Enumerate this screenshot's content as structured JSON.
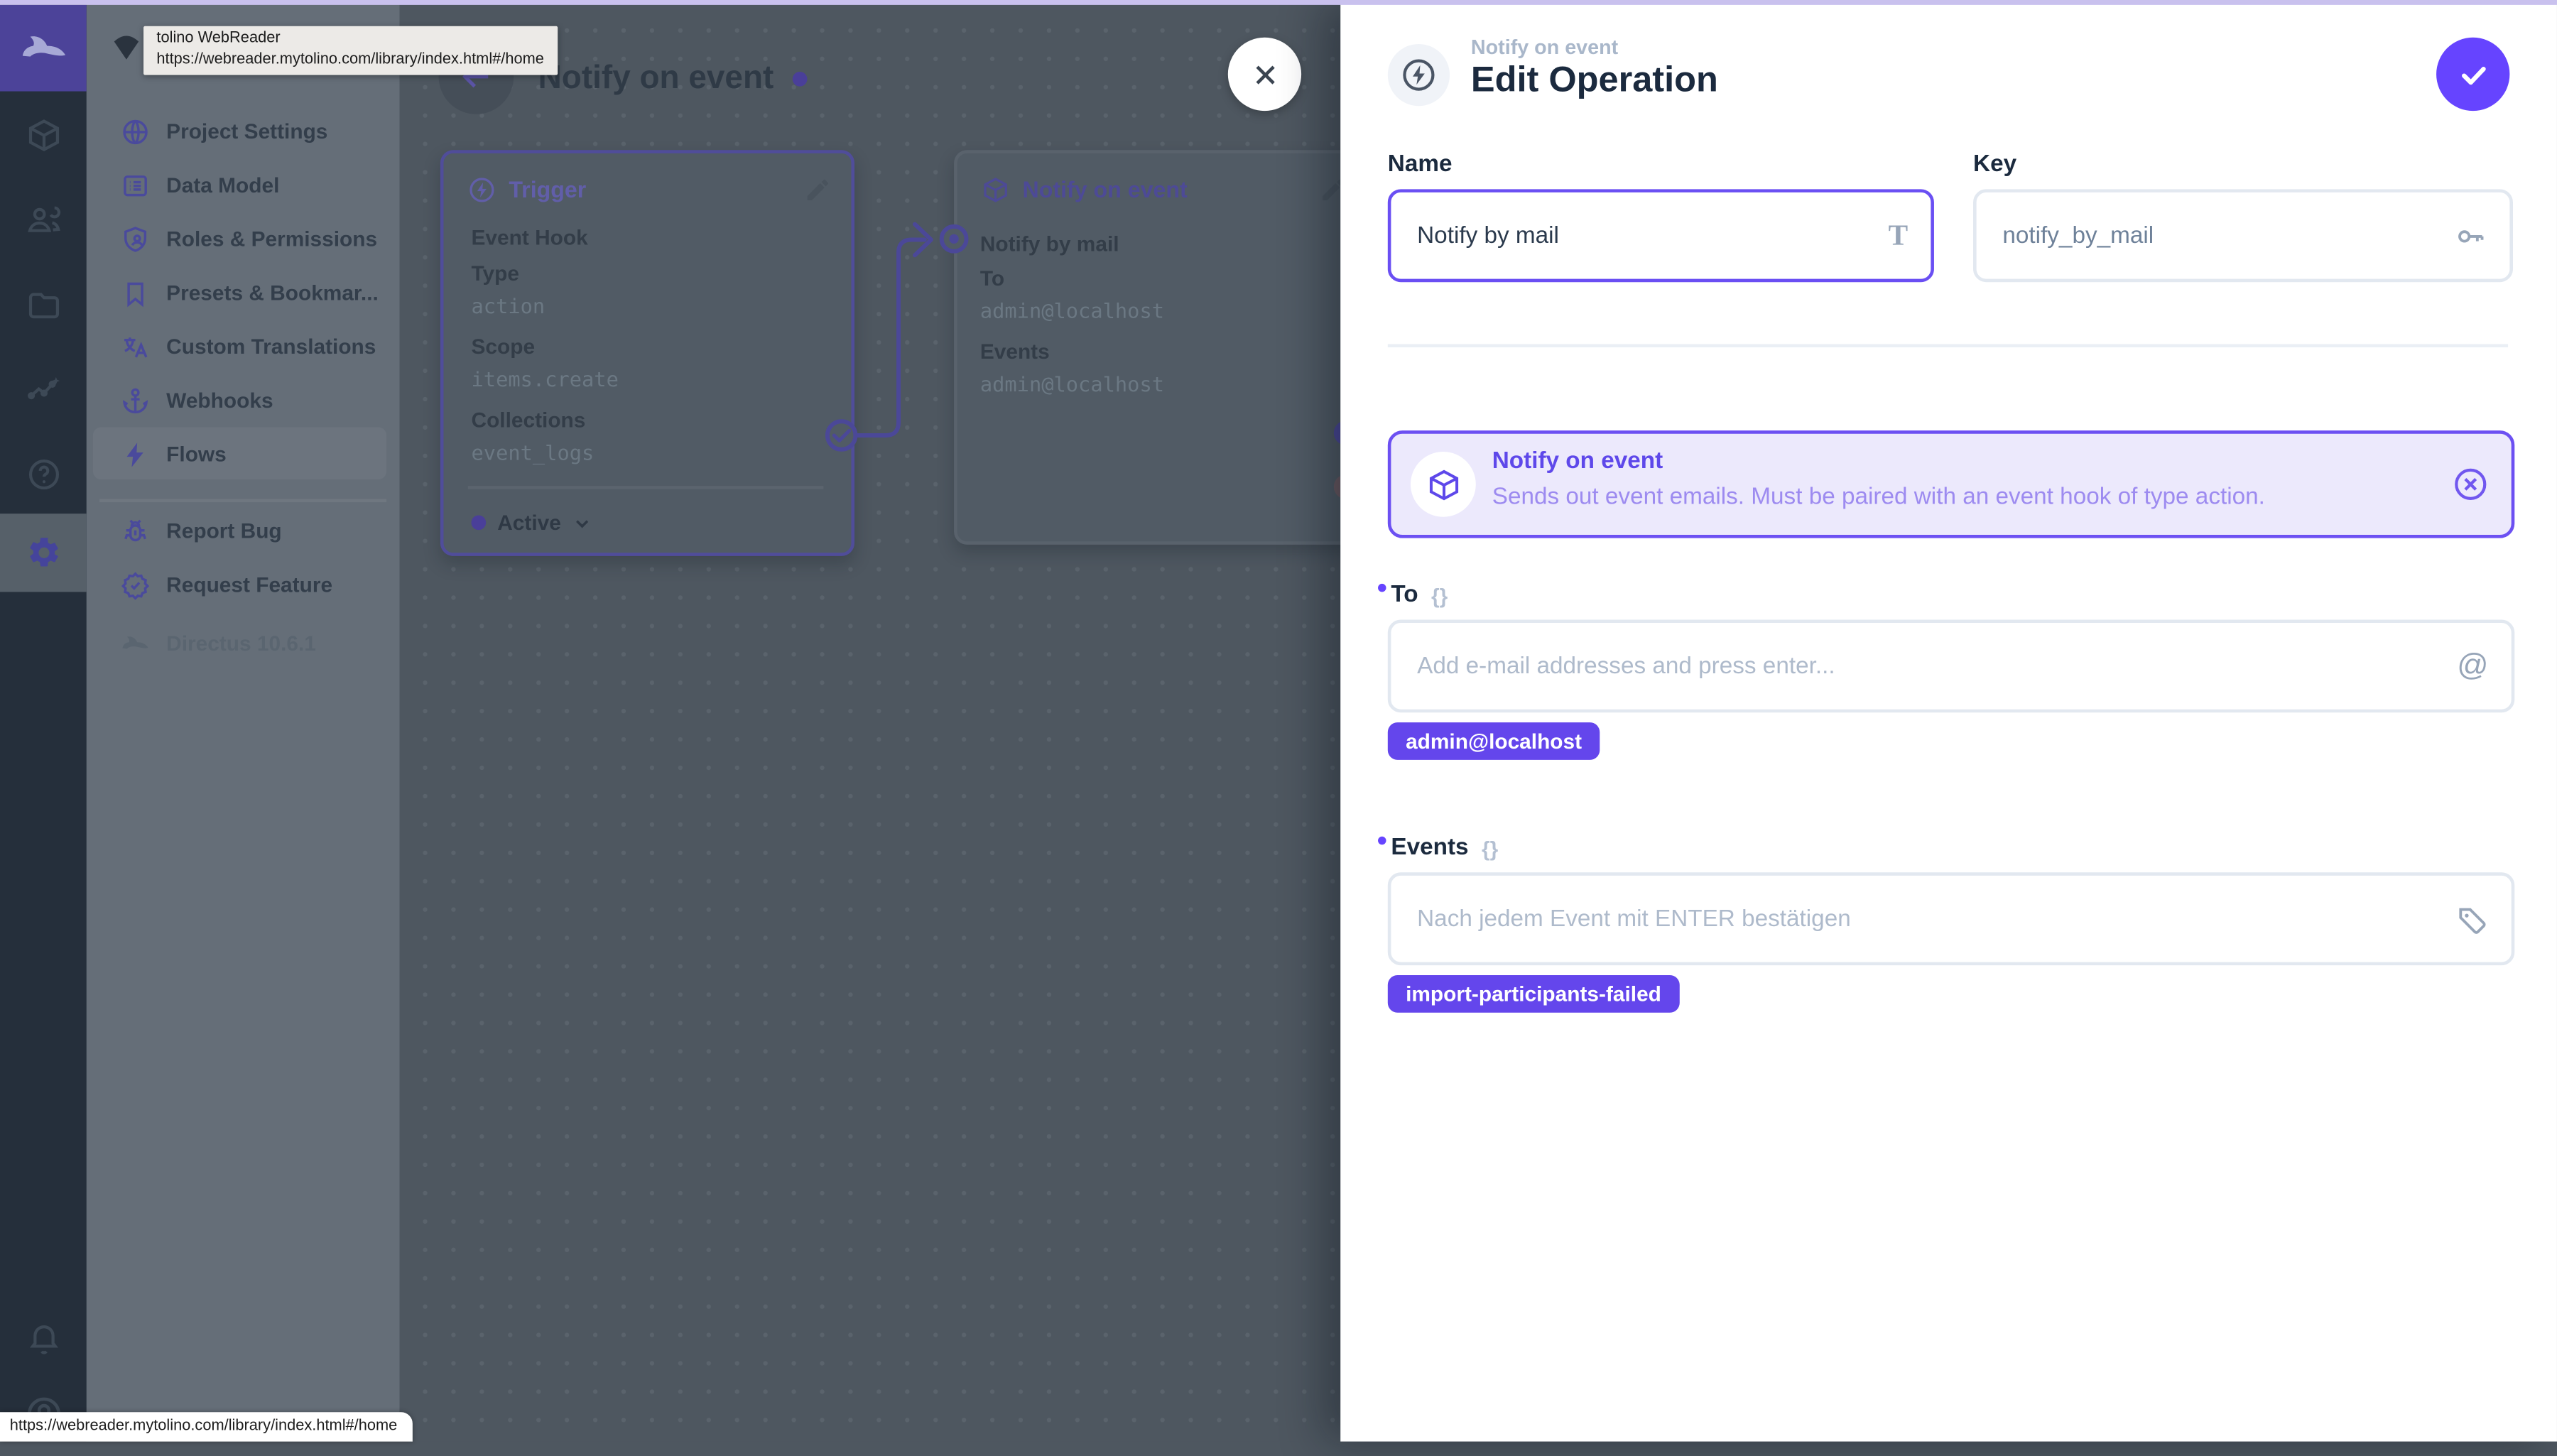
{
  "browser": {
    "tooltip": {
      "title": "tolino WebReader",
      "url": "https://webreader.mytolino.com/library/index.html#/home"
    },
    "status_url": "https://webreader.mytolino.com/library/index.html#/home"
  },
  "module_bar": {
    "modules": [
      "content",
      "users",
      "files",
      "insights",
      "help",
      "settings"
    ],
    "active_module": "settings",
    "bottom": [
      "notifications",
      "account"
    ]
  },
  "sidebar": {
    "items": [
      {
        "label": "Project Settings",
        "icon": "globe"
      },
      {
        "label": "Data Model",
        "icon": "list"
      },
      {
        "label": "Roles & Permissions",
        "icon": "shield-person"
      },
      {
        "label": "Presets & Bookmar...",
        "icon": "bookmark"
      },
      {
        "label": "Custom Translations",
        "icon": "translate"
      },
      {
        "label": "Webhooks",
        "icon": "anchor"
      },
      {
        "label": "Flows",
        "icon": "bolt"
      }
    ],
    "active_item": "Flows",
    "footer_items": [
      {
        "label": "Report Bug",
        "icon": "bug"
      },
      {
        "label": "Request Feature",
        "icon": "new-releases"
      }
    ],
    "version": "Directus 10.6.1"
  },
  "workspace": {
    "title": "Notify on event",
    "trigger_panel": {
      "title": "Trigger",
      "name": "Event Hook",
      "fields": [
        {
          "label": "Type",
          "value": "action"
        },
        {
          "label": "Scope",
          "value": "items.create"
        },
        {
          "label": "Collections",
          "value": "event_logs"
        }
      ],
      "status": "Active"
    },
    "operation_panel": {
      "title": "Notify on event",
      "name": "Notify by mail",
      "fields": [
        {
          "label": "To",
          "value": "admin@localhost"
        },
        {
          "label": "Events",
          "value": "admin@localhost"
        }
      ]
    }
  },
  "drawer": {
    "overline": "Notify on event",
    "title": "Edit Operation",
    "name_field": {
      "label": "Name",
      "value": "Notify by mail"
    },
    "key_field": {
      "label": "Key",
      "value": "notify_by_mail"
    },
    "notice": {
      "title": "Notify on event",
      "description": "Sends out event emails. Must be paired with an event hook of type action."
    },
    "to_field": {
      "label": "To",
      "placeholder": "Add e-mail addresses and press enter...",
      "chips": [
        "admin@localhost"
      ]
    },
    "events_field": {
      "label": "Events",
      "placeholder": "Nach jedem Event mit ENTER bestätigen",
      "chips": [
        "import-participants-failed"
      ]
    }
  },
  "icons": {
    "braces": "{}",
    "at": "@",
    "title_glyph": "T"
  },
  "colors": {
    "accent": "#6644FF",
    "chip": "#6446EC",
    "notice_bg": "#ECE9FC",
    "notice_border": "#6C50F2",
    "drawer_bg": "#FFFFFF",
    "module_bar_bg": "#252F3B",
    "sidebar_bg": "#656E78",
    "workspace_bg": "#4E5760",
    "panel_bg": "#515B65",
    "panel_border_active": "#504D9A",
    "title_text": "#1B2A3E",
    "muted_text": "#A9B7CA"
  }
}
